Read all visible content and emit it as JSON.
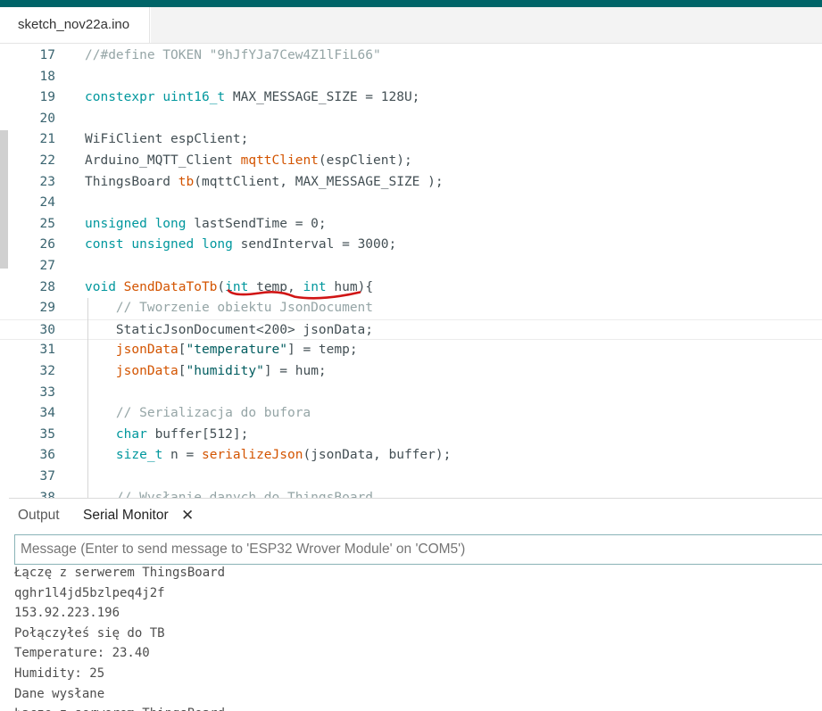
{
  "colors": {
    "topbar": "#006468",
    "keyword": "#00979d",
    "function": "#d35400",
    "comment": "#95a5a6",
    "string": "#005c5f",
    "annotation": "#d01515"
  },
  "editor": {
    "tab_label": "sketch_nov22a.ino",
    "current_line": "30",
    "lines": [
      {
        "n": "17",
        "text": "//#define TOKEN \"9hJfYJa7Cew4Z1lFiL66\""
      },
      {
        "n": "18",
        "text": ""
      },
      {
        "n": "19",
        "text": "constexpr uint16_t MAX_MESSAGE_SIZE = 128U;"
      },
      {
        "n": "20",
        "text": ""
      },
      {
        "n": "21",
        "text": "WiFiClient espClient;"
      },
      {
        "n": "22",
        "text": "Arduino_MQTT_Client mqttClient(espClient);"
      },
      {
        "n": "23",
        "text": "ThingsBoard tb(mqttClient, MAX_MESSAGE_SIZE );"
      },
      {
        "n": "24",
        "text": ""
      },
      {
        "n": "25",
        "text": "unsigned long lastSendTime = 0;"
      },
      {
        "n": "26",
        "text": "const unsigned long sendInterval = 3000;"
      },
      {
        "n": "27",
        "text": ""
      },
      {
        "n": "28",
        "text": "void SendDataToTb(int temp, int hum){"
      },
      {
        "n": "29",
        "text": "    // Tworzenie obiektu JsonDocument"
      },
      {
        "n": "30",
        "text": "    StaticJsonDocument<200> jsonData;"
      },
      {
        "n": "31",
        "text": "    jsonData[\"temperature\"] = temp;"
      },
      {
        "n": "32",
        "text": "    jsonData[\"humidity\"] = hum;"
      },
      {
        "n": "33",
        "text": ""
      },
      {
        "n": "34",
        "text": "    // Serializacja do bufora"
      },
      {
        "n": "35",
        "text": "    char buffer[512];"
      },
      {
        "n": "36",
        "text": "    size_t n = serializeJson(jsonData, buffer);"
      },
      {
        "n": "37",
        "text": ""
      },
      {
        "n": "38",
        "text": "    // Wysłanie danych do ThingsBoard"
      }
    ]
  },
  "panel": {
    "tabs": [
      {
        "label": "Output"
      },
      {
        "label": "Serial Monitor"
      }
    ],
    "close_icon": "close-icon",
    "message_placeholder": "Message (Enter to send message to 'ESP32 Wrover Module' on 'COM5')",
    "message_value": ""
  },
  "serial_output": [
    "Łączę z serwerem ThingsBoard",
    "qghr1l4jd5bzlpeq4j2f",
    "153.92.223.196",
    "Połączyłeś się do TB",
    "Temperature: 23.40",
    "Humidity: 25",
    "Dane wysłane",
    "Łączę z serwerem ThingsBoard"
  ]
}
